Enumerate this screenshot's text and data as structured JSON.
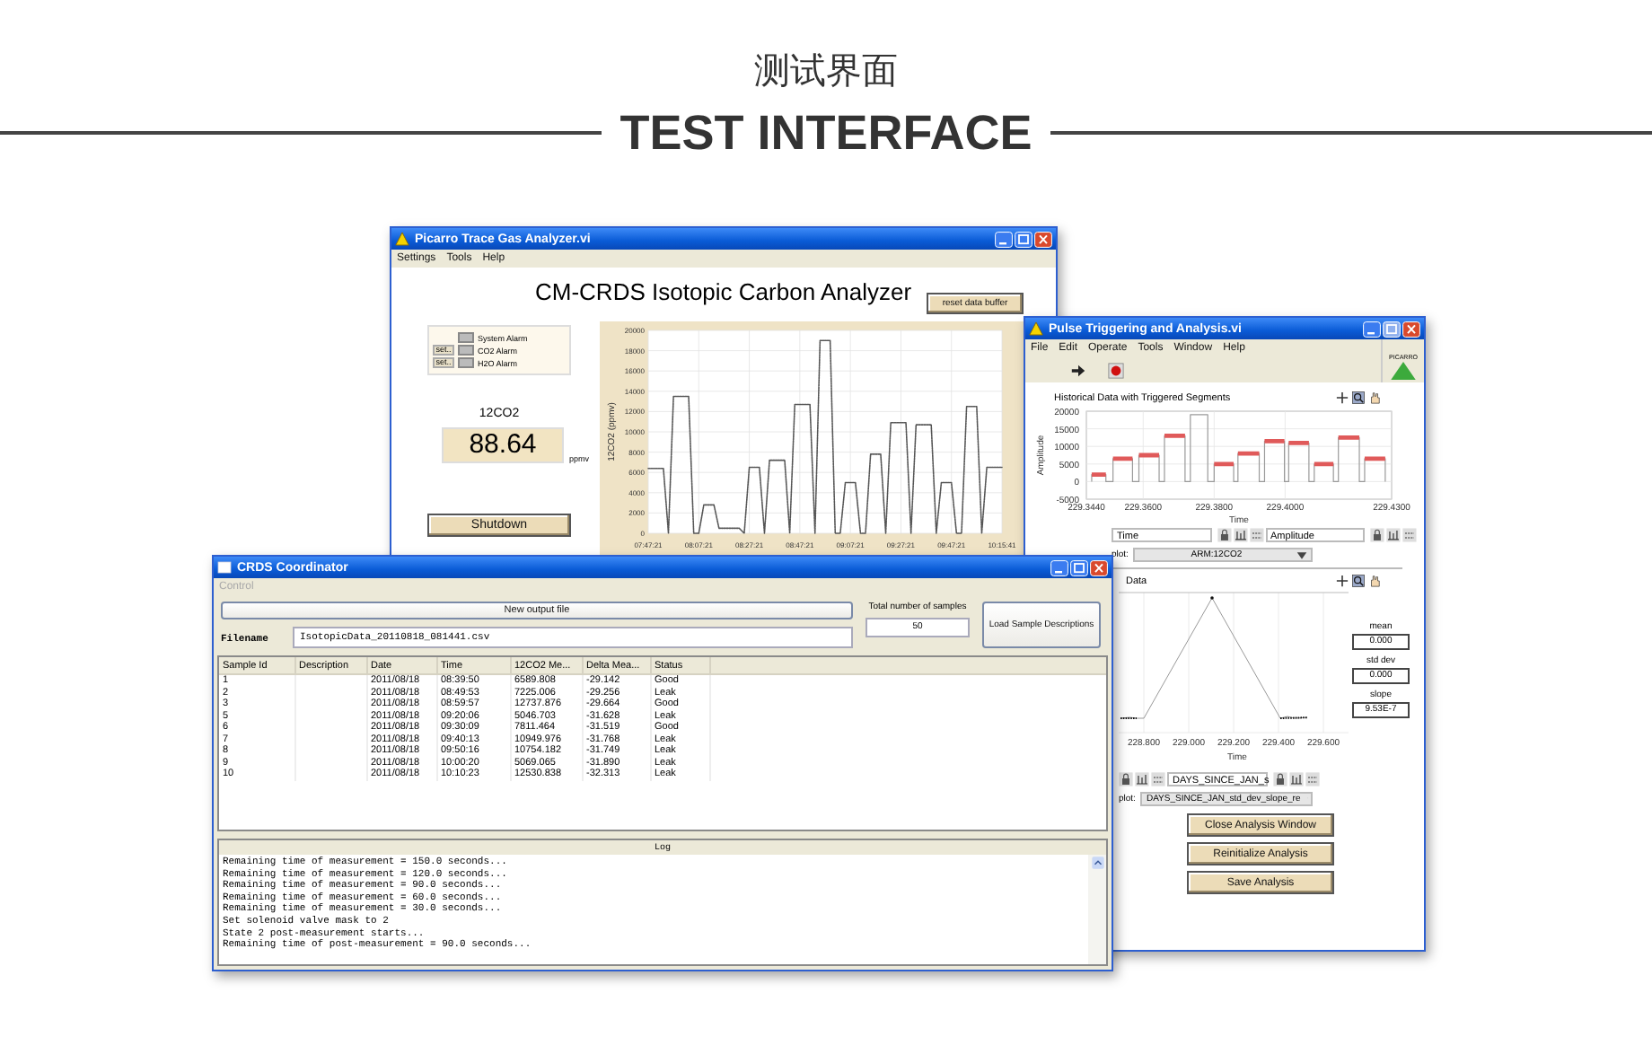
{
  "header": {
    "title": "测试界面",
    "subtitle": "TEST INTERFACE"
  },
  "analyzer_window": {
    "title": "Picarro Trace Gas Analyzer.vi",
    "menu": [
      "Settings",
      "Tools",
      "Help"
    ],
    "heading": "CM-CRDS Isotopic Carbon Analyzer",
    "reset_button": "reset data buffer",
    "alarms": [
      {
        "label": "System Alarm"
      },
      {
        "label": "CO2 Alarm",
        "button": "set.."
      },
      {
        "label": "H2O Alarm",
        "button": "set.."
      }
    ],
    "reading": {
      "label": "12CO2",
      "value": "88.64",
      "unit": "ppmv"
    },
    "shutdown_button": "Shutdown",
    "chart_data": {
      "type": "line",
      "ylabel": "12CO2 (ppmv)",
      "grid": true,
      "categories": [
        "07:47:21",
        null,
        null,
        null,
        null,
        null,
        null,
        null,
        null,
        null,
        "08:07:21",
        null,
        null,
        null,
        null,
        null,
        null,
        null,
        null,
        null,
        "08:27:21",
        null,
        null,
        null,
        null,
        null,
        null,
        null,
        null,
        null,
        "08:47:21",
        null,
        null,
        null,
        null,
        null,
        null,
        null,
        null,
        null,
        "09:07:21",
        null,
        null,
        null,
        null,
        null,
        null,
        null,
        null,
        null,
        "09:27:21",
        null,
        null,
        null,
        null,
        null,
        null,
        null,
        null,
        null,
        "09:47:21",
        null,
        null,
        null,
        null,
        null,
        null,
        null,
        null,
        null,
        "10:15:41"
      ],
      "series": [
        {
          "color": "#555555",
          "line_style": "dotted",
          "values": [
            6400,
            6400,
            6400,
            6400,
            0,
            13500,
            13500,
            13500,
            13500,
            0,
            0,
            2800,
            2800,
            2800,
            500,
            500,
            500,
            500,
            500,
            0,
            6500,
            6500,
            6500,
            0,
            7200,
            7200,
            7200,
            7200,
            0,
            12700,
            12700,
            12700,
            12700,
            0,
            19000,
            19000,
            19000,
            0,
            0,
            5000,
            5000,
            5000,
            0,
            0,
            7800,
            7800,
            7800,
            0,
            10900,
            10900,
            10900,
            10900,
            0,
            10700,
            10700,
            10700,
            10700,
            0,
            5000,
            5000,
            5000,
            0,
            0,
            12500,
            12500,
            12500,
            0,
            6500,
            6500,
            6500,
            6500
          ]
        }
      ],
      "ylim": [
        0,
        20000
      ],
      "yticks": [
        0,
        2000,
        4000,
        6000,
        8000,
        10000,
        12000,
        14000,
        16000,
        18000,
        20000
      ]
    }
  },
  "pulse_window": {
    "title": "Pulse Triggering and Analysis.vi",
    "menu": [
      "File",
      "Edit",
      "Operate",
      "Tools",
      "Window",
      "Help"
    ],
    "logo_text": "PICARRO",
    "history_chart": {
      "title": "Historical Data with Triggered Segments",
      "chart_data": {
        "type": "line",
        "xlabel": "Time",
        "ylabel": "Amplitude",
        "grid": true,
        "x": [
          229.3455,
          229.3455,
          229.3495,
          229.3495,
          229.3515,
          229.3515,
          229.357,
          229.357,
          229.3588,
          229.3588,
          229.3645,
          229.3645,
          229.366,
          229.366,
          229.3718,
          229.3718,
          229.3733,
          229.3733,
          229.3782,
          229.3782,
          229.38,
          229.38,
          229.3855,
          229.3855,
          229.3867,
          229.3867,
          229.3927,
          229.3927,
          229.3942,
          229.3942,
          229.3998,
          229.3998,
          229.401,
          229.401,
          229.4067,
          229.4067,
          229.4082,
          229.4082,
          229.4136,
          229.4136,
          229.415,
          229.415,
          229.4209,
          229.4209,
          229.4224,
          229.4224,
          229.4282,
          229.4282
        ],
        "series": [
          {
            "color": "#9a9a9a",
            "values": [
              0,
              2000,
              2000,
              0,
              0,
              6500,
              6500,
              0,
              0,
              7500,
              7500,
              0,
              0,
              13000,
              13000,
              0,
              0,
              19000,
              19000,
              0,
              0,
              5000,
              5000,
              0,
              0,
              8000,
              8000,
              0,
              0,
              11500,
              11500,
              0,
              0,
              11000,
              11000,
              0,
              0,
              5000,
              5000,
              0,
              0,
              12500,
              12500,
              0,
              0,
              6500,
              6500,
              0
            ]
          },
          {
            "color": "#e05a5a",
            "values": [
              null,
              2000,
              2000,
              null,
              null,
              6500,
              6500,
              null,
              null,
              7500,
              7500,
              null,
              null,
              13000,
              13000,
              null,
              null,
              null,
              null,
              null,
              null,
              5000,
              5000,
              null,
              null,
              8000,
              8000,
              null,
              null,
              11500,
              11500,
              null,
              null,
              11000,
              11000,
              null,
              null,
              5000,
              5000,
              null,
              null,
              12500,
              12500,
              null,
              null,
              6500,
              6500,
              null
            ]
          }
        ],
        "xlim": [
          229.344,
          229.43
        ],
        "ylim": [
          -5000,
          20000
        ],
        "xticks": [
          {
            "value": 229.344,
            "label": "229.3440"
          },
          {
            "value": 229.36,
            "label": "229.3600"
          },
          {
            "value": 229.38,
            "label": "229.3800"
          },
          {
            "value": 229.4,
            "label": "229.4000"
          },
          {
            "value": 229.43,
            "label": "229.4300"
          }
        ],
        "yticks": [
          -5000,
          0,
          5000,
          10000,
          15000,
          20000
        ]
      }
    },
    "axis_fields": [
      "Time",
      "Amplitude"
    ],
    "plot_select": {
      "label": "plot:",
      "value": "ARM:12CO2"
    },
    "segment_chart": {
      "title": "Data",
      "xlabel": "Time",
      "x_tick_labels": [
        "228.800",
        "229.000",
        "229.200",
        "229.400",
        "229.600"
      ]
    },
    "stats": [
      {
        "label": "mean",
        "value": "0.000"
      },
      {
        "label": "std dev",
        "value": "0.000"
      },
      {
        "label": "slope",
        "value": "9.53E-7"
      }
    ],
    "axis_fields_2": [
      "DAYS_SINCE_JAN_s"
    ],
    "plot_select_2": {
      "label": "plot:",
      "value": "DAYS_SINCE_JAN_std_dev_slope_re"
    },
    "buttons": [
      "Close Analysis Window",
      "Reinitialize Analysis",
      "Save Analysis"
    ]
  },
  "coordinator_window": {
    "title": "CRDS Coordinator",
    "menu": [
      {
        "label": "Control",
        "disabled": true
      }
    ],
    "new_file_button": "New output file",
    "filename_label": "Filename",
    "filename": "IsotopicData_20110818_081441.csv",
    "total_label": "Total number of samples",
    "total": "50",
    "load_button": "Load Sample Descriptions",
    "table": {
      "columns": [
        "Sample Id",
        "Description",
        "Date",
        "Time",
        "12CO2 Me...",
        "Delta Mea...",
        "Status"
      ],
      "rows": [
        {
          "id": "1",
          "date": "2011/08/18",
          "time": "08:39:50",
          "co2": "6589.808",
          "delta": "-29.142",
          "status": "Good"
        },
        {
          "id": "2",
          "date": "2011/08/18",
          "time": "08:49:53",
          "co2": "7225.006",
          "delta": "-29.256",
          "status": "Leak"
        },
        {
          "id": "3",
          "date": "2011/08/18",
          "time": "08:59:57",
          "co2": "12737.876",
          "delta": "-29.664",
          "status": "Good"
        },
        {
          "id": "5",
          "date": "2011/08/18",
          "time": "09:20:06",
          "co2": "5046.703",
          "delta": "-31.628",
          "status": "Leak"
        },
        {
          "id": "6",
          "date": "2011/08/18",
          "time": "09:30:09",
          "co2": "7811.464",
          "delta": "-31.519",
          "status": "Good"
        },
        {
          "id": "7",
          "date": "2011/08/18",
          "time": "09:40:13",
          "co2": "10949.976",
          "delta": "-31.768",
          "status": "Leak"
        },
        {
          "id": "8",
          "date": "2011/08/18",
          "time": "09:50:16",
          "co2": "10754.182",
          "delta": "-31.749",
          "status": "Leak"
        },
        {
          "id": "9",
          "date": "2011/08/18",
          "time": "10:00:20",
          "co2": "5069.065",
          "delta": "-31.890",
          "status": "Leak"
        },
        {
          "id": "10",
          "date": "2011/08/18",
          "time": "10:10:23",
          "co2": "12530.838",
          "delta": "-32.313",
          "status": "Leak"
        }
      ]
    },
    "log": {
      "title": "Log",
      "lines": [
        "Remaining time of measurement = 150.0 seconds...",
        "Remaining time of measurement = 120.0 seconds...",
        "Remaining time of measurement = 90.0 seconds...",
        "Remaining time of measurement = 60.0 seconds...",
        "Remaining time of measurement = 30.0 seconds...",
        "Set solenoid valve mask to 2",
        "State 2 post-measurement starts...",
        "Remaining time of post-measurement = 90.0 seconds..."
      ]
    }
  }
}
